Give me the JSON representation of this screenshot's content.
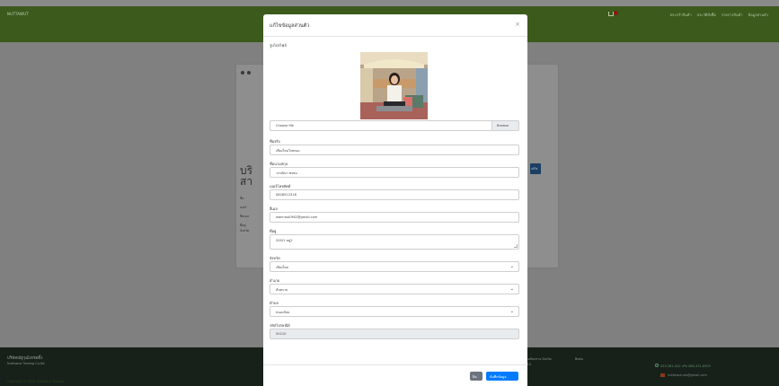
{
  "topbar": {
    "brand": "NUTTAWUT",
    "nav": [
      "ตระกร้าสินค้า",
      "ประวัติสั่งซื้อ",
      "รายการสินค้า",
      "ข้อมูลส่วนตัว"
    ]
  },
  "background": {
    "heading_line1": "บริ",
    "heading_line2": "สา",
    "small_labels": [
      "ชื่อ",
      "เบอร์",
      "ชื่อเมล",
      "ที่อยู่",
      "จังหวัด"
    ],
    "edit_button": "แก้ไข"
  },
  "footer": {
    "company_thai": "บริษัทณัฐวุฒิเทรดดิ้ง",
    "company_eng": "Nuttawut Trading Co.ltd",
    "address_line1": "อำเภอสันทราย จังหวัด",
    "address_line2": "50210",
    "contact_title": "ติดต่อ",
    "phone": "053-381-042 หรือ 086-431-8505",
    "email": "nuttawut-wa@gmail.com",
    "copyright": "Copyright © 2021 Nuttawut Trading"
  },
  "modal": {
    "title": "แก้ไขข้อมูลส่วนตัว",
    "close_glyph": "×",
    "profile_label": "รูปโปรไฟล์",
    "file_placeholder": "Choose file",
    "browse_label": "Browse",
    "firstname_label": "ชื่อจริง",
    "firstname_value": "เพียงใหม่โกฮทอง",
    "lastname_label": "ชื่อนามสกุล",
    "lastname_value": "วรรณิษา พรหม",
    "phone_label": "เบอร์โทรศัพท์",
    "phone_value": "0828512318",
    "email_label": "อีเมล",
    "email_value": "wannisa1962@gmail.com",
    "address_label": "ที่อยู่",
    "address_value": "200/1 หมู่2",
    "province_label": "จังหวัด",
    "province_value": "เชียงใหม่",
    "district_label": "อำเภอ",
    "district_value": "สันทราย",
    "subdistrict_label": "ตำบล",
    "subdistrict_value": "หนองจ๊อม",
    "zip_label": "รหัสไปรษณีย์",
    "zip_value": "50210",
    "close_button": "ปิด",
    "save_button": "บันทึกข้อมูล"
  }
}
